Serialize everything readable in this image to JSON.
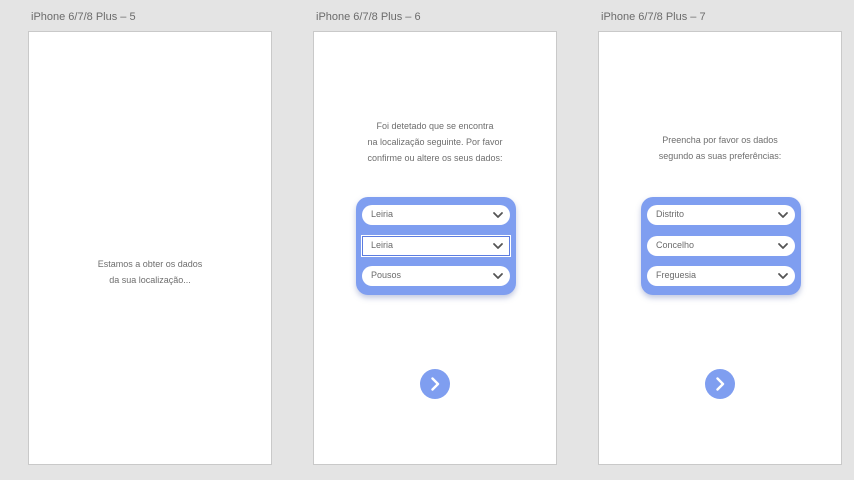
{
  "colors": {
    "accent": "#7f9ef0",
    "canvas": "#e4e4e4",
    "artboard": "#ffffff"
  },
  "artboards": [
    {
      "title": "iPhone 6/7/8 Plus – 5",
      "message": "Estamos a obter os dados\nda sua localização..."
    },
    {
      "title": "iPhone 6/7/8 Plus – 6",
      "message": "Foi detetado que se encontra\nna localização seguinte. Por favor\nconfirme ou altere os seus dados:",
      "fields": [
        "Leiria",
        "Leiria",
        "Pousos"
      ],
      "next_icon": "chevron-right-icon"
    },
    {
      "title": "iPhone 6/7/8 Plus – 7",
      "message": "Preencha por favor os dados\nsegundo as suas preferências:",
      "fields": [
        "Distrito",
        "Concelho",
        "Freguesia"
      ],
      "next_icon": "chevron-right-icon"
    }
  ]
}
